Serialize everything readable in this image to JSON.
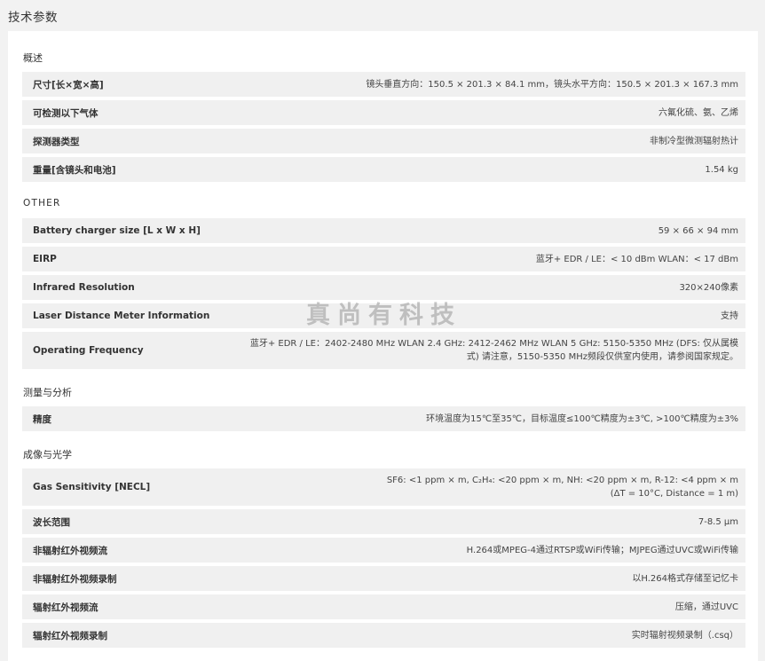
{
  "page": {
    "title": "技术参数"
  },
  "sections": [
    {
      "title": "概述",
      "rows": [
        {
          "label": "尺寸[长×宽×高]",
          "value": "镜头垂直方向：150.5 × 201.3 × 84.1 mm，镜头水平方向：150.5 × 201.3 × 167.3 mm"
        },
        {
          "label": "可检测以下气体",
          "value": "六氟化硫、氨、乙烯"
        },
        {
          "label": "探测器类型",
          "value": "非制冷型微测辐射热计"
        },
        {
          "label": "重量[含镜头和电池]",
          "value": "1.54 kg"
        }
      ]
    },
    {
      "title": "OTHER",
      "rows": [
        {
          "label": "Battery charger size [L x W x H]",
          "value": "59 × 66 × 94 mm"
        },
        {
          "label": "EIRP",
          "value": "蓝牙+ EDR / LE：< 10 dBm WLAN：< 17 dBm"
        },
        {
          "label": "Infrared Resolution",
          "value": "320×240像素"
        },
        {
          "label": "Laser Distance Meter Information",
          "value": "支持"
        },
        {
          "label": "Operating Frequency",
          "value": "蓝牙+ EDR / LE：2402-2480 MHz WLAN 2.4 GHz: 2412-2462 MHz WLAN 5 GHz: 5150-5350 MHz (DFS: 仅从属模式) 请注意，5150-5350 MHz频段仅供室内使用，请参阅国家规定。"
        }
      ]
    },
    {
      "title": "测量与分析",
      "rows": [
        {
          "label": "精度",
          "value": "环境温度为15℃至35℃，目标温度≤100℃精度为±3℃, >100℃精度为±3%"
        }
      ]
    },
    {
      "title": "成像与光学",
      "rows": [
        {
          "label": "Gas Sensitivity [NECL]",
          "value": "SF6: <1 ppm × m, C₂H₄: <20 ppm × m, NH: <20 ppm × m, R-12: <4 ppm × m (ΔT = 10°C, Distance = 1 m)"
        },
        {
          "label": "波长范围",
          "value": "7-8.5 μm"
        },
        {
          "label": "非辐射红外视频流",
          "value": "H.264或MPEG-4通过RTSP或WiFi传输；MJPEG通过UVC或WiFi传输"
        },
        {
          "label": "非辐射红外视频录制",
          "value": "以H.264格式存储至记忆卡"
        },
        {
          "label": "辐射红外视频流",
          "value": "压缩，通过UVC"
        },
        {
          "label": "辐射红外视频录制",
          "value": "实时辐射视频录制（.csq）"
        }
      ]
    }
  ],
  "watermark": {
    "text": "真尚有科技"
  }
}
